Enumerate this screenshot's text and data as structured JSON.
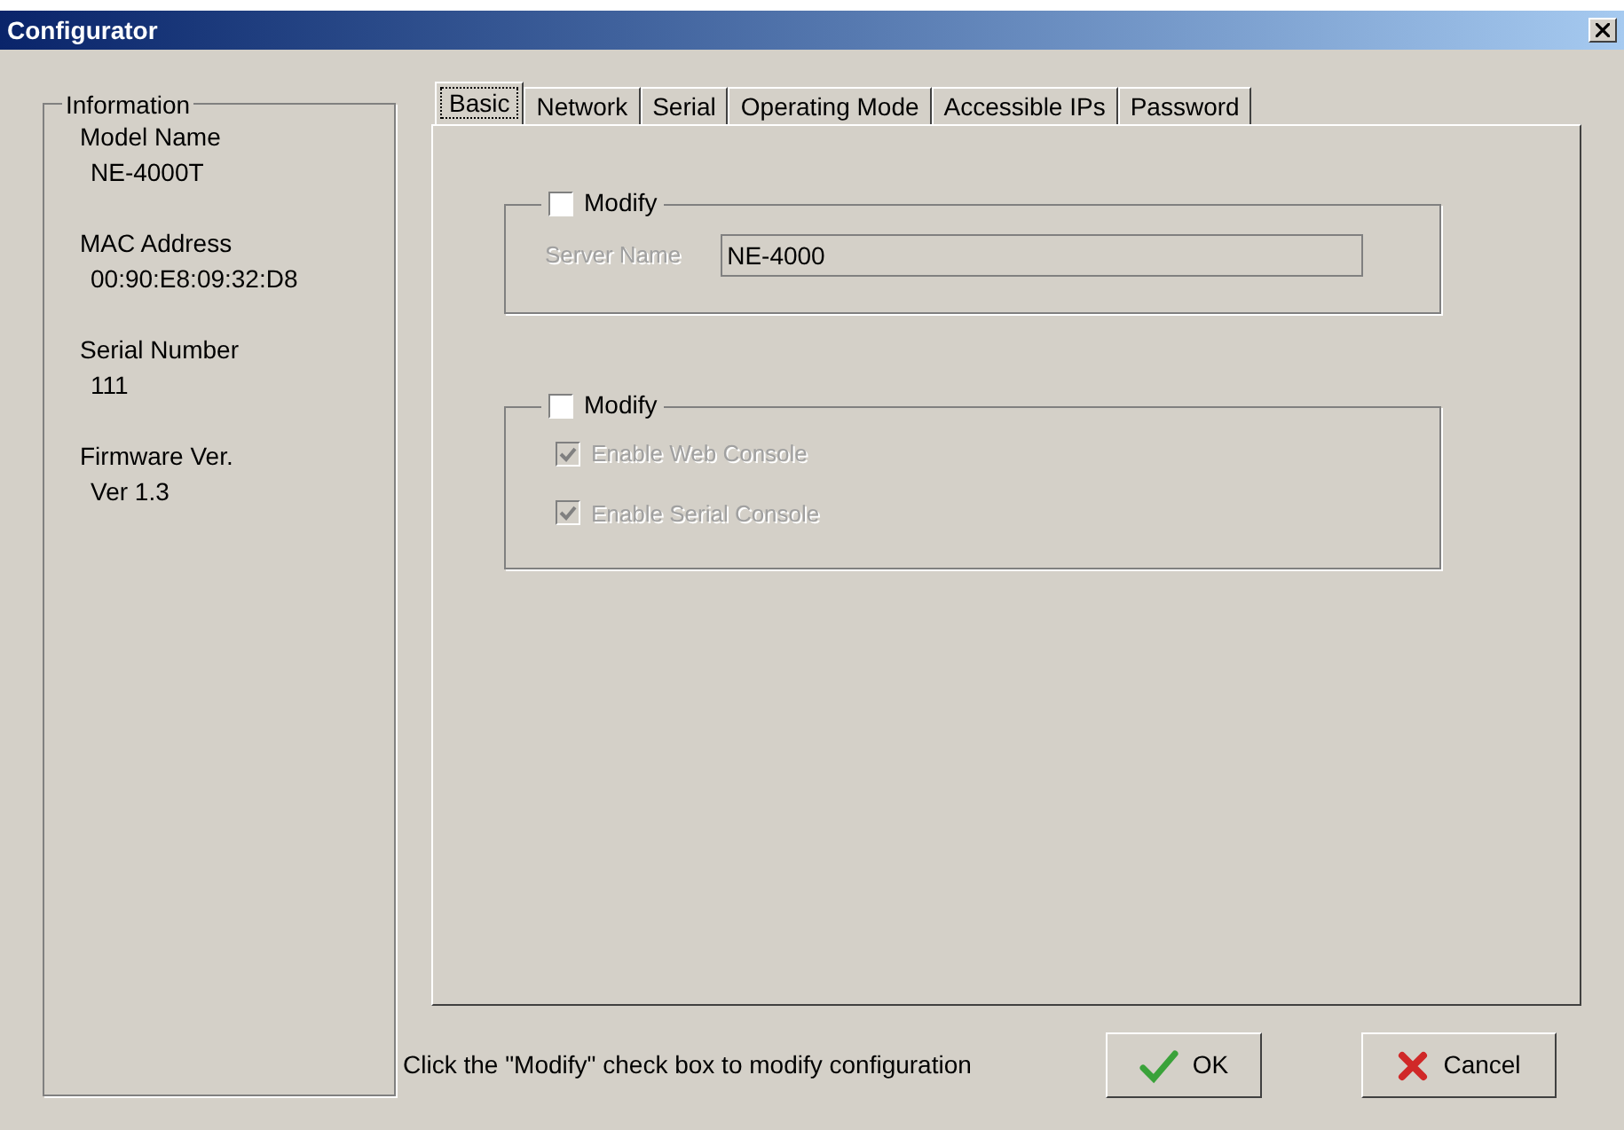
{
  "window": {
    "title": "Configurator"
  },
  "information": {
    "title": "Information",
    "items": [
      {
        "label": "Model Name",
        "value": "NE-4000T"
      },
      {
        "label": "MAC Address",
        "value": "00:90:E8:09:32:D8"
      },
      {
        "label": "Serial Number",
        "value": "111"
      },
      {
        "label": "Firmware Ver.",
        "value": "Ver 1.3"
      }
    ]
  },
  "tabs": [
    {
      "label": "Basic",
      "selected": true
    },
    {
      "label": "Network",
      "selected": false
    },
    {
      "label": "Serial",
      "selected": false
    },
    {
      "label": "Operating Mode",
      "selected": false
    },
    {
      "label": "Accessible IPs",
      "selected": false
    },
    {
      "label": "Password",
      "selected": false
    }
  ],
  "server_group": {
    "modify": {
      "label": "Modify",
      "checked": false
    },
    "field": {
      "label": "Server Name",
      "value": "NE-4000",
      "disabled": true
    }
  },
  "console_group": {
    "modify": {
      "label": "Modify",
      "checked": false
    },
    "options": [
      {
        "label": "Enable Web Console",
        "checked": true,
        "disabled": true
      },
      {
        "label": "Enable Serial Console",
        "checked": true,
        "disabled": true
      }
    ]
  },
  "hint": "Click the \"Modify\" check box to modify configuration",
  "buttons": [
    {
      "label": "OK",
      "kind": "ok"
    },
    {
      "label": "Cancel",
      "kind": "cancel"
    }
  ]
}
